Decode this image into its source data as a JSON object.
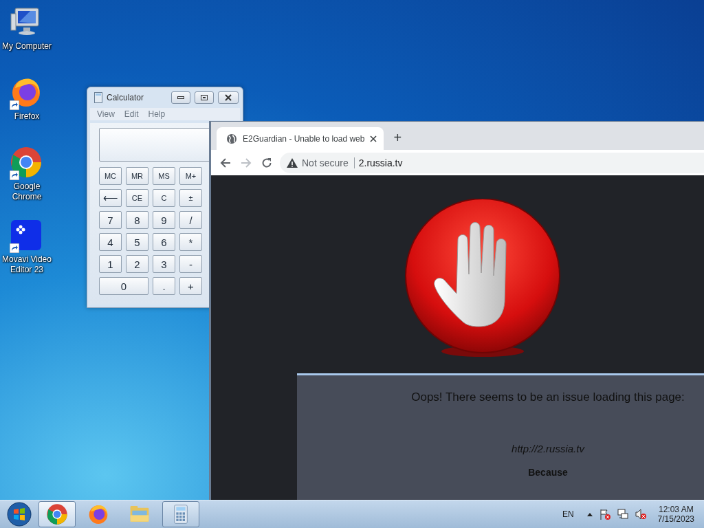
{
  "desktop_icons": [
    {
      "label": "My Computer",
      "kind": "computer",
      "shortcut": false
    },
    {
      "label": "Firefox",
      "kind": "firefox",
      "shortcut": true
    },
    {
      "label": "Google Chrome",
      "kind": "chrome",
      "shortcut": true
    },
    {
      "label": "Movavi Video Editor 23",
      "kind": "movavi",
      "shortcut": true
    }
  ],
  "calculator": {
    "title": "Calculator",
    "menu": [
      "View",
      "Edit",
      "Help"
    ],
    "buttons": [
      [
        {
          "label": "MC",
          "wide": false
        },
        {
          "label": "MR",
          "wide": false
        },
        {
          "label": "MS",
          "wide": false
        },
        {
          "label": "M+",
          "wide": false
        }
      ],
      [
        {
          "label": "⟵",
          "wide": false
        },
        {
          "label": "CE",
          "wide": false
        },
        {
          "label": "C",
          "wide": false
        },
        {
          "label": "±",
          "wide": false
        }
      ],
      [
        {
          "label": "7",
          "wide": false
        },
        {
          "label": "8",
          "wide": false
        },
        {
          "label": "9",
          "wide": false
        },
        {
          "label": "/",
          "wide": false
        }
      ],
      [
        {
          "label": "4",
          "wide": false
        },
        {
          "label": "5",
          "wide": false
        },
        {
          "label": "6",
          "wide": false
        },
        {
          "label": "*",
          "wide": false
        }
      ],
      [
        {
          "label": "1",
          "wide": false
        },
        {
          "label": "2",
          "wide": false
        },
        {
          "label": "3",
          "wide": false
        },
        {
          "label": "-",
          "wide": false
        }
      ],
      [
        {
          "label": "0",
          "wide": true
        },
        {
          "label": ".",
          "wide": false
        },
        {
          "label": "+",
          "wide": false
        }
      ]
    ]
  },
  "browser": {
    "tab": {
      "title": "E2Guardian - Unable to load web",
      "selected": true
    },
    "new_tab": "+",
    "address": {
      "security": "Not secure",
      "url": "2.russia.tv"
    },
    "page": {
      "heading": "Oops! There seems to be an issue loading this page:",
      "url": "http://2.russia.tv",
      "because": "Because"
    }
  },
  "taskbar": {
    "apps": [
      {
        "kind": "chrome",
        "running": true,
        "selected": true
      },
      {
        "kind": "firefox",
        "running": false,
        "selected": false
      },
      {
        "kind": "explorer",
        "running": false,
        "selected": false
      },
      {
        "kind": "calculator",
        "running": true,
        "selected": false
      }
    ],
    "language": "EN",
    "time": "12:03 AM",
    "date": "7/15/2023"
  }
}
